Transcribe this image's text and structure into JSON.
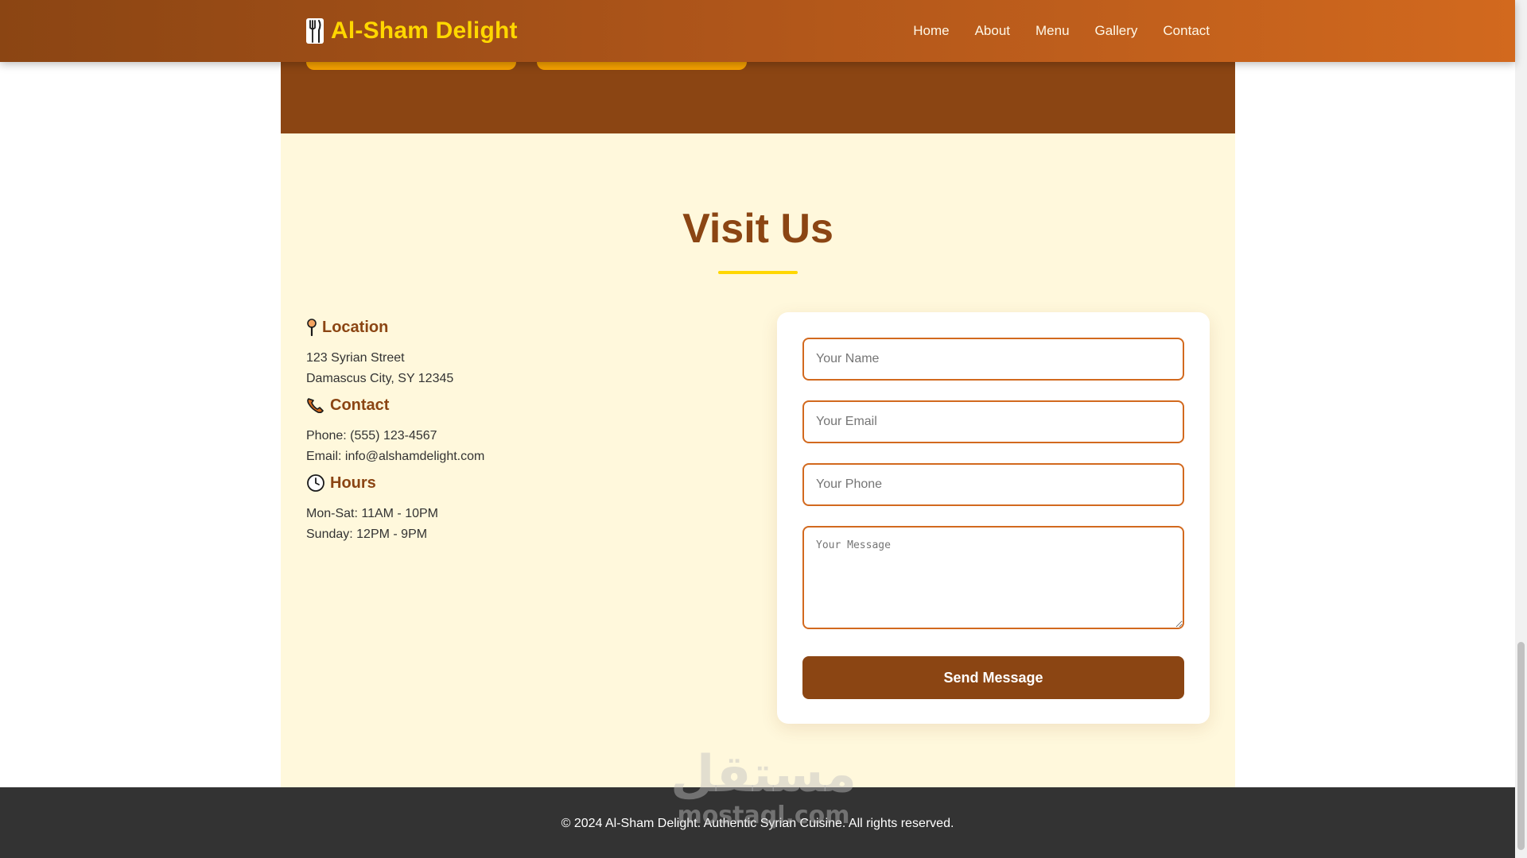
{
  "header": {
    "brand": "Al-Sham Delight",
    "nav": [
      "Home",
      "About",
      "Menu",
      "Gallery",
      "Contact"
    ]
  },
  "contact": {
    "title": "Visit Us",
    "location": {
      "heading": "Location",
      "lines": [
        "123 Syrian Street",
        "Damascus City, SY 12345"
      ]
    },
    "contact_info": {
      "heading": "Contact",
      "lines": [
        "Phone: (555) 123-4567",
        "Email: info@alshamdelight.com"
      ]
    },
    "hours": {
      "heading": "Hours",
      "lines": [
        "Mon-Sat: 11AM - 10PM",
        "Sunday: 12PM - 9PM"
      ]
    },
    "form": {
      "name_placeholder": "Your Name",
      "email_placeholder": "Your Email",
      "phone_placeholder": "Your Phone",
      "message_placeholder": "Your Message",
      "submit_label": "Send Message"
    }
  },
  "footer": {
    "text": "© 2024 Al-Sham Delight. Authentic Syrian Cuisine. All rights reserved."
  },
  "watermark": {
    "arabic": "مستقل",
    "latin": "mostaql.com"
  },
  "colors": {
    "primary": "#8b4513",
    "accent": "#ffd700",
    "section_bg": "#fff8dc",
    "footer_bg": "#333333"
  }
}
